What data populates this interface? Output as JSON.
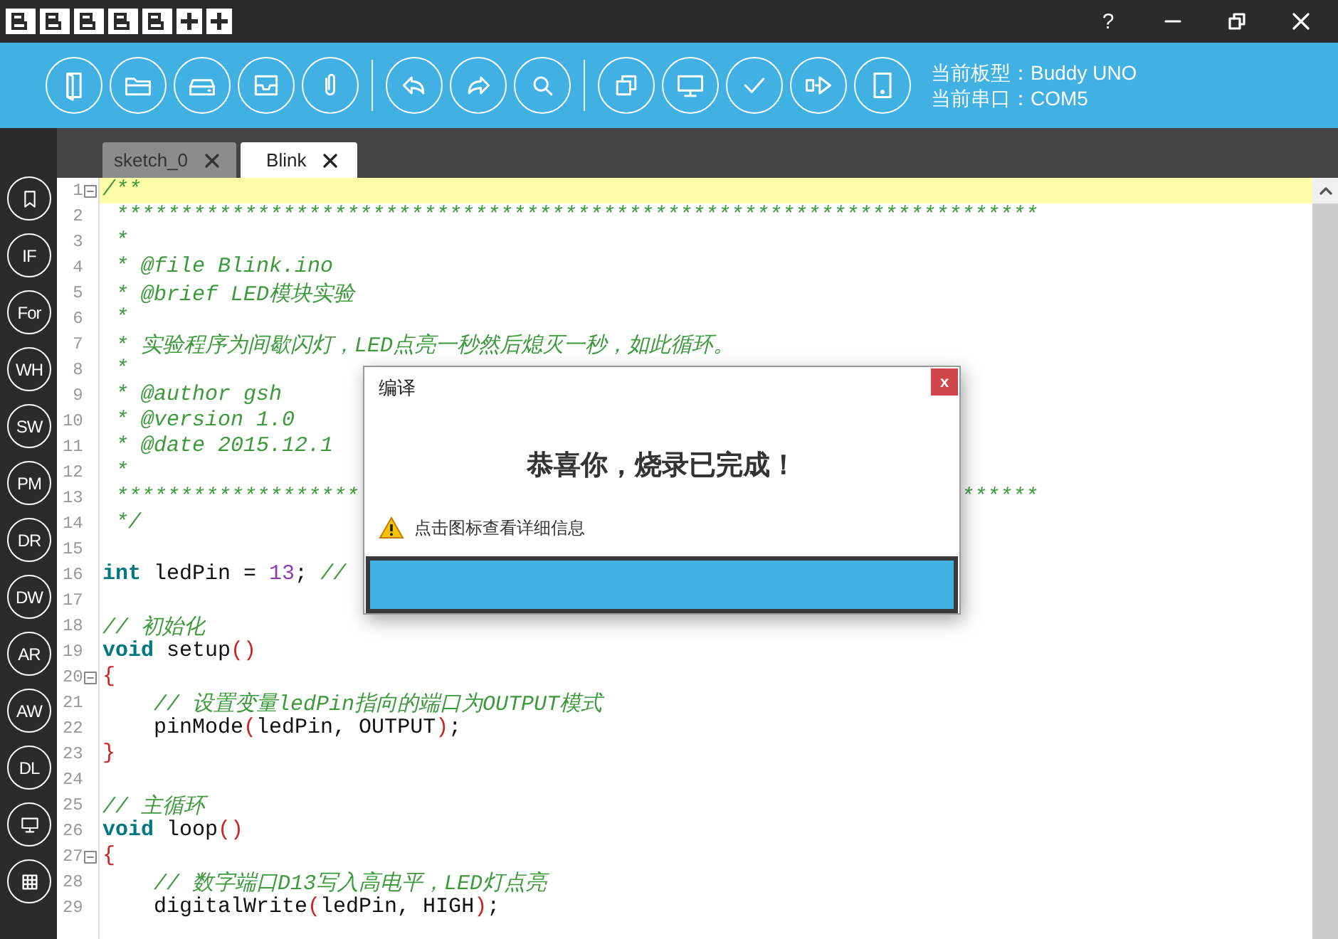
{
  "title_bar": {
    "help": "?"
  },
  "toolbar": {
    "buttons": [
      {
        "kind": "new"
      },
      {
        "kind": "open"
      },
      {
        "kind": "save"
      },
      {
        "kind": "tray"
      },
      {
        "kind": "attach"
      },
      {
        "kind": "separator"
      },
      {
        "kind": "undo"
      },
      {
        "kind": "redo"
      },
      {
        "kind": "search"
      },
      {
        "kind": "separator"
      },
      {
        "kind": "copy"
      },
      {
        "kind": "monitor"
      },
      {
        "kind": "verify"
      },
      {
        "kind": "upload"
      },
      {
        "kind": "device"
      }
    ],
    "board_label": "当前板型：Buddy UNO",
    "port_label": "当前串口：COM5"
  },
  "tabs": [
    {
      "label": "sketch_0",
      "selected": false
    },
    {
      "label": "Blink",
      "selected": true
    }
  ],
  "sidebar": {
    "items": [
      {
        "kind": "bookmark"
      },
      {
        "kind": "text",
        "label": "IF"
      },
      {
        "kind": "text",
        "label": "For"
      },
      {
        "kind": "text",
        "label": "WH"
      },
      {
        "kind": "text",
        "label": "SW"
      },
      {
        "kind": "text",
        "label": "PM"
      },
      {
        "kind": "text",
        "label": "DR"
      },
      {
        "kind": "text",
        "label": "DW"
      },
      {
        "kind": "text",
        "label": "AR"
      },
      {
        "kind": "text",
        "label": "AW"
      },
      {
        "kind": "text",
        "label": "DL"
      },
      {
        "kind": "monitor"
      },
      {
        "kind": "grid"
      }
    ]
  },
  "editor": {
    "lines": [
      {
        "number": "1",
        "current": true,
        "foldable": true,
        "segments": [
          {
            "kind": "comment",
            "text": "/**"
          }
        ]
      },
      {
        "number": "2",
        "current": false,
        "foldable": false,
        "segments": [
          {
            "kind": "comment",
            "text": " ************************************************************************"
          }
        ]
      },
      {
        "number": "3",
        "current": false,
        "foldable": false,
        "segments": [
          {
            "kind": "comment",
            "text": " *"
          }
        ]
      },
      {
        "number": "4",
        "current": false,
        "foldable": false,
        "segments": [
          {
            "kind": "comment",
            "text": " * @file Blink.ino"
          }
        ]
      },
      {
        "number": "5",
        "current": false,
        "foldable": false,
        "segments": [
          {
            "kind": "comment",
            "text": " * @brief LED模块实验"
          }
        ]
      },
      {
        "number": "6",
        "current": false,
        "foldable": false,
        "segments": [
          {
            "kind": "comment",
            "text": " *"
          }
        ]
      },
      {
        "number": "7",
        "current": false,
        "foldable": false,
        "segments": [
          {
            "kind": "comment",
            "text": " * 实验程序为间歇闪灯，LED点亮一秒然后熄灭一秒，如此循环。"
          }
        ]
      },
      {
        "number": "8",
        "current": false,
        "foldable": false,
        "segments": [
          {
            "kind": "comment",
            "text": " *"
          }
        ]
      },
      {
        "number": "9",
        "current": false,
        "foldable": false,
        "segments": [
          {
            "kind": "comment",
            "text": " * @author gsh"
          }
        ]
      },
      {
        "number": "10",
        "current": false,
        "foldable": false,
        "segments": [
          {
            "kind": "comment",
            "text": " * @version 1.0"
          }
        ]
      },
      {
        "number": "11",
        "current": false,
        "foldable": false,
        "segments": [
          {
            "kind": "comment",
            "text": " * @date 2015.12.1"
          }
        ]
      },
      {
        "number": "12",
        "current": false,
        "foldable": false,
        "segments": [
          {
            "kind": "comment",
            "text": " *"
          }
        ]
      },
      {
        "number": "13",
        "current": false,
        "foldable": false,
        "segments": [
          {
            "kind": "comment",
            "text": " *******************"
          },
          {
            "kind": "comment",
            "text": "******",
            "after_gap": true
          }
        ]
      },
      {
        "number": "14",
        "current": false,
        "foldable": false,
        "segments": [
          {
            "kind": "comment",
            "text": " */"
          }
        ]
      },
      {
        "number": "15",
        "current": false,
        "foldable": false
      },
      {
        "number": "16",
        "current": false,
        "foldable": false,
        "segments": [
          {
            "kind": "keyword",
            "text": "int"
          },
          {
            "kind": "plain",
            "text": " ledPin = "
          },
          {
            "kind": "number",
            "text": "13"
          },
          {
            "kind": "plain",
            "text": "; "
          },
          {
            "kind": "comment",
            "text": "//"
          }
        ]
      },
      {
        "number": "17",
        "current": false,
        "foldable": false
      },
      {
        "number": "18",
        "current": false,
        "foldable": false,
        "segments": [
          {
            "kind": "comment",
            "text": "// 初始化"
          }
        ]
      },
      {
        "number": "19",
        "current": false,
        "foldable": false,
        "segments": [
          {
            "kind": "keyword",
            "text": "void"
          },
          {
            "kind": "plain",
            "text": " setup"
          },
          {
            "kind": "paren",
            "text": "()"
          }
        ]
      },
      {
        "number": "20",
        "current": false,
        "foldable": true,
        "segments": [
          {
            "kind": "paren",
            "text": "{"
          }
        ]
      },
      {
        "number": "21",
        "current": false,
        "foldable": false,
        "segments": [
          {
            "kind": "comment",
            "text": "    // 设置变量ledPin指向的端口为OUTPUT模式"
          }
        ]
      },
      {
        "number": "22",
        "current": false,
        "foldable": false,
        "segments": [
          {
            "kind": "plain",
            "text": "    pinMode"
          },
          {
            "kind": "paren",
            "text": "("
          },
          {
            "kind": "plain",
            "text": "ledPin, OUTPUT"
          },
          {
            "kind": "paren",
            "text": ")"
          },
          {
            "kind": "plain",
            "text": ";"
          }
        ]
      },
      {
        "number": "23",
        "current": false,
        "foldable": false,
        "segments": [
          {
            "kind": "paren",
            "text": "}"
          }
        ]
      },
      {
        "number": "24",
        "current": false,
        "foldable": false
      },
      {
        "number": "25",
        "current": false,
        "foldable": false,
        "segments": [
          {
            "kind": "comment",
            "text": "// 主循环"
          }
        ]
      },
      {
        "number": "26",
        "current": false,
        "foldable": false,
        "segments": [
          {
            "kind": "keyword",
            "text": "void"
          },
          {
            "kind": "plain",
            "text": " loop"
          },
          {
            "kind": "paren",
            "text": "()"
          }
        ]
      },
      {
        "number": "27",
        "current": false,
        "foldable": true,
        "segments": [
          {
            "kind": "paren",
            "text": "{"
          }
        ]
      },
      {
        "number": "28",
        "current": false,
        "foldable": false,
        "segments": [
          {
            "kind": "comment",
            "text": "    // 数字端口D13写入高电平，LED灯点亮"
          }
        ]
      },
      {
        "number": "29",
        "current": false,
        "foldable": false,
        "segments": [
          {
            "kind": "plain",
            "text": "    digitalWrite"
          },
          {
            "kind": "paren",
            "text": "("
          },
          {
            "kind": "plain",
            "text": "ledPin, HIGH"
          },
          {
            "kind": "paren",
            "text": ")"
          },
          {
            "kind": "plain",
            "text": ";"
          }
        ]
      }
    ]
  },
  "dialog": {
    "title": "编译",
    "close": "x",
    "message": "恭喜你，烧录已完成！",
    "hint": "点击图标查看详细信息",
    "progress": {
      "level": 1
    }
  }
}
